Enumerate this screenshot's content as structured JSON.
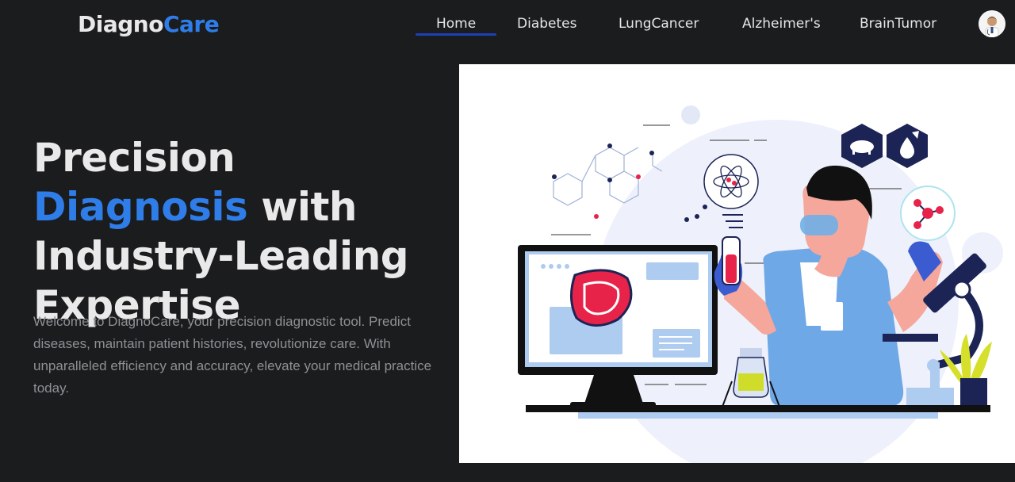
{
  "brand": {
    "part1": "Diagno",
    "part2": "Care"
  },
  "nav": {
    "home": "Home",
    "diabetes": "Diabetes",
    "lung": "LungCancer",
    "alzheimers": "Alzheimer's",
    "brain": "BrainTumor"
  },
  "hero": {
    "title_part1": "Precision ",
    "title_accent": "Diagnosis",
    "title_part2": " with Industry-Leading Expertise",
    "description": "Welcome to DiagnoCare, your precision diagnostic tool. Predict diseases, maintain patient histories, revolutionize care. With unparalleled efficiency and accuracy, elevate your medical practice today."
  },
  "colors": {
    "background": "#1b1c1e",
    "accent": "#2f7de9",
    "nav_underline": "#1d3fb8",
    "heading": "#e9e9e9",
    "body_text": "#8f9094"
  }
}
